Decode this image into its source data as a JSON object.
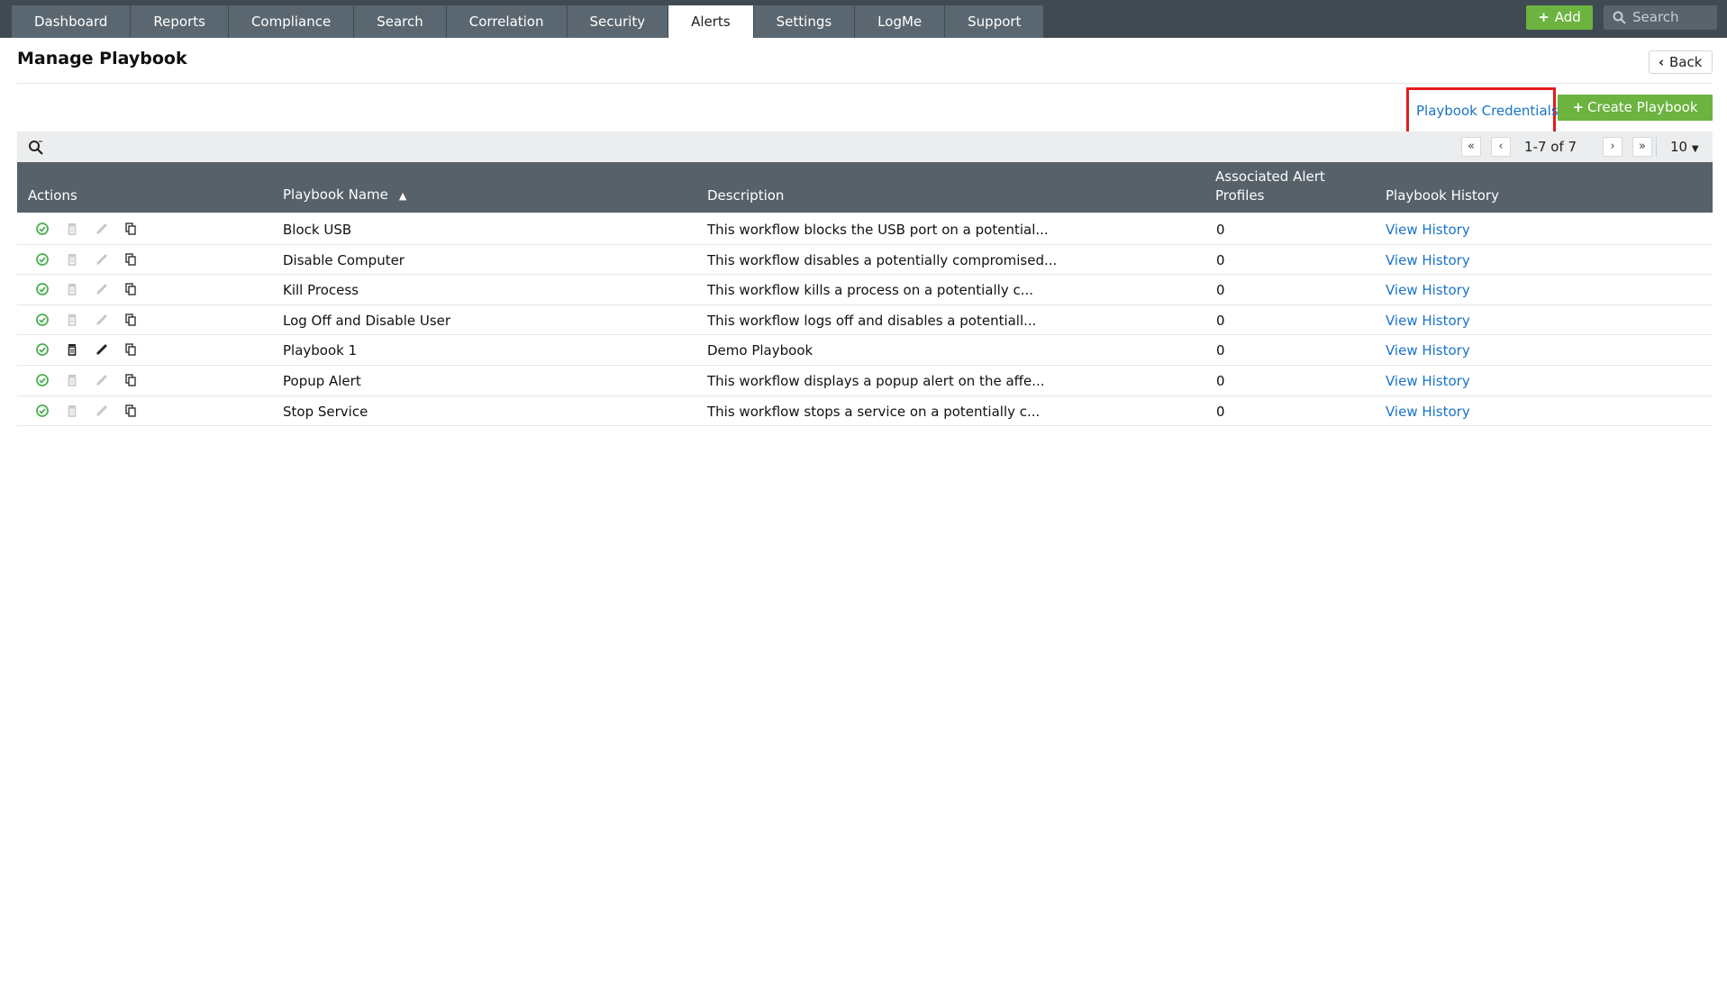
{
  "nav": {
    "tabs": [
      {
        "label": "Dashboard"
      },
      {
        "label": "Reports"
      },
      {
        "label": "Compliance"
      },
      {
        "label": "Search"
      },
      {
        "label": "Correlation"
      },
      {
        "label": "Security"
      },
      {
        "label": "Alerts"
      },
      {
        "label": "Settings"
      },
      {
        "label": "LogMe"
      },
      {
        "label": "Support"
      }
    ],
    "active_tab": "Alerts",
    "add_label": "Add",
    "search_placeholder": "Search"
  },
  "page": {
    "title": "Manage Playbook",
    "back_label": "Back",
    "credentials_link": "Playbook Credentials",
    "create_label": "Create Playbook"
  },
  "pagination": {
    "info": "1-7 of 7",
    "page_size": "10"
  },
  "table": {
    "columns": {
      "actions": "Actions",
      "name": "Playbook Name",
      "description": "Description",
      "profiles_line1": "Associated Alert",
      "profiles_line2": "Profiles",
      "history": "Playbook History"
    },
    "rows": [
      {
        "name": "Block USB",
        "description": "This workflow blocks the USB port on a potential...",
        "profiles": "0",
        "history": "View History",
        "editable": false
      },
      {
        "name": "Disable Computer",
        "description": "This workflow disables a potentially compromised...",
        "profiles": "0",
        "history": "View History",
        "editable": false
      },
      {
        "name": "Kill Process",
        "description": "This workflow kills a process on a potentially c...",
        "profiles": "0",
        "history": "View History",
        "editable": false
      },
      {
        "name": "Log Off and Disable User",
        "description": "This workflow logs off and disables a potentiall...",
        "profiles": "0",
        "history": "View History",
        "editable": false
      },
      {
        "name": "Playbook 1",
        "description": "Demo Playbook",
        "profiles": "0",
        "history": "View History",
        "editable": true
      },
      {
        "name": "Popup Alert",
        "description": "This workflow displays a popup alert on the affe...",
        "profiles": "0",
        "history": "View History",
        "editable": false
      },
      {
        "name": "Stop Service",
        "description": "This workflow stops a service on a potentially c...",
        "profiles": "0",
        "history": "View History",
        "editable": false
      }
    ]
  },
  "colors": {
    "nav_bg": "#3f4a53",
    "tab_bg": "#5b6770",
    "accent_green": "#6cb33f",
    "link_blue": "#1a73c6",
    "highlight_red": "#e21c1c"
  }
}
